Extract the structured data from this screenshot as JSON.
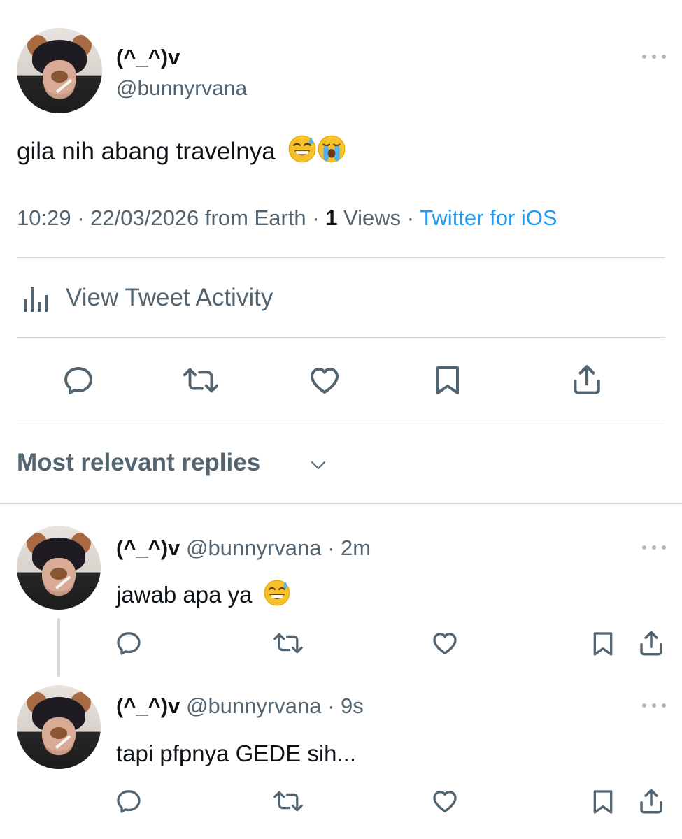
{
  "main_tweet": {
    "display_name": "(^_^)v",
    "handle": "@bunnyrvana",
    "text": "gila nih abang travelnya",
    "emojis": [
      "sweat-smile-emoji",
      "loudly-crying-emoji"
    ],
    "meta": {
      "time": "10:29",
      "sep1": " · ",
      "date": "22/03/2026",
      "location": " from Earth",
      "sep2": " · ",
      "views_count": "1",
      "views_label": " Views",
      "sep3": " · ",
      "source": "Twitter for iOS"
    },
    "activity_label": "View Tweet Activity"
  },
  "replies_header": "Most relevant replies",
  "replies": [
    {
      "display_name": "(^_^)v",
      "handle": "@bunnyrvana",
      "sep": " · ",
      "time": "2m",
      "text": "jawab apa ya",
      "emoji": "sweat-smile-emoji"
    },
    {
      "display_name": "(^_^)v",
      "handle": "@bunnyrvana",
      "sep": " · ",
      "time": "9s",
      "text": "tapi pfpnya GEDE sih..."
    }
  ],
  "colors": {
    "text": "#0f1419",
    "muted": "#536471",
    "link": "#1d9bf0",
    "divider": "#cfd9de"
  }
}
